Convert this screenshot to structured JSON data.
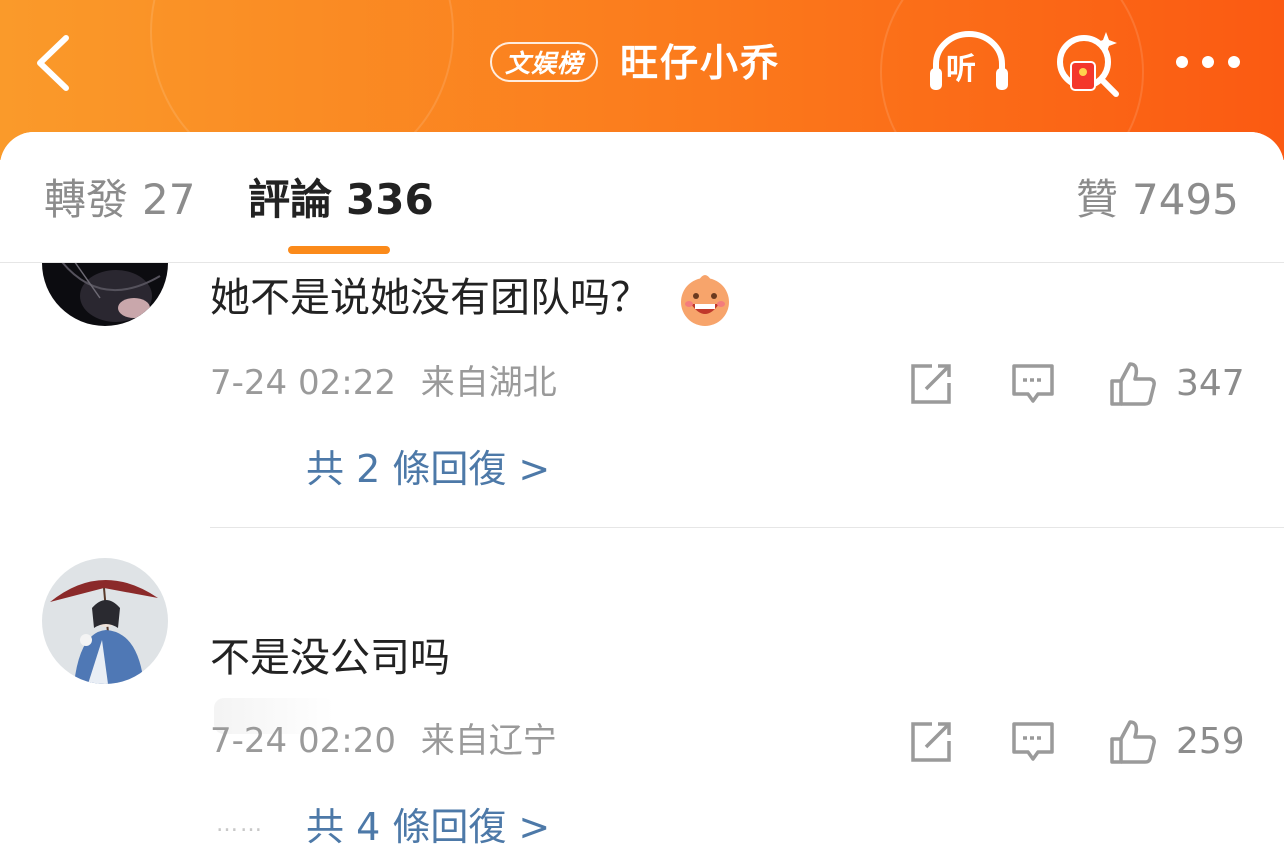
{
  "header": {
    "badge": "文娱榜",
    "title": "旺仔小乔",
    "listen_label": "听",
    "icons": [
      "chevron-left-icon",
      "headphones-icon",
      "search-redpacket-icon",
      "more-dots-icon"
    ],
    "colors": {
      "gradient_start": "#fa9a2a",
      "gradient_end": "#fb5a12"
    }
  },
  "tabs": [
    {
      "label": "轉發",
      "count": "27"
    },
    {
      "label": "評論",
      "count": "336",
      "active": true
    },
    {
      "label": "贊",
      "count": "7495"
    }
  ],
  "comments": [
    {
      "text": "她不是说她没有团队吗？",
      "emoji": "laughing-emoji-icon",
      "time": "7-24 02:22",
      "location": "来自湖北",
      "likes": "347",
      "replies": "共 2 條回復 >"
    },
    {
      "text": "不是没公司吗",
      "time": "7-24 02:20",
      "location": "来自辽宁",
      "likes": "259",
      "replies": "共 4 條回復 >",
      "dots": "……"
    }
  ],
  "colors": {
    "accent": "#fb8a1a",
    "link": "#4d79a8",
    "muted": "#9a9a9a"
  }
}
